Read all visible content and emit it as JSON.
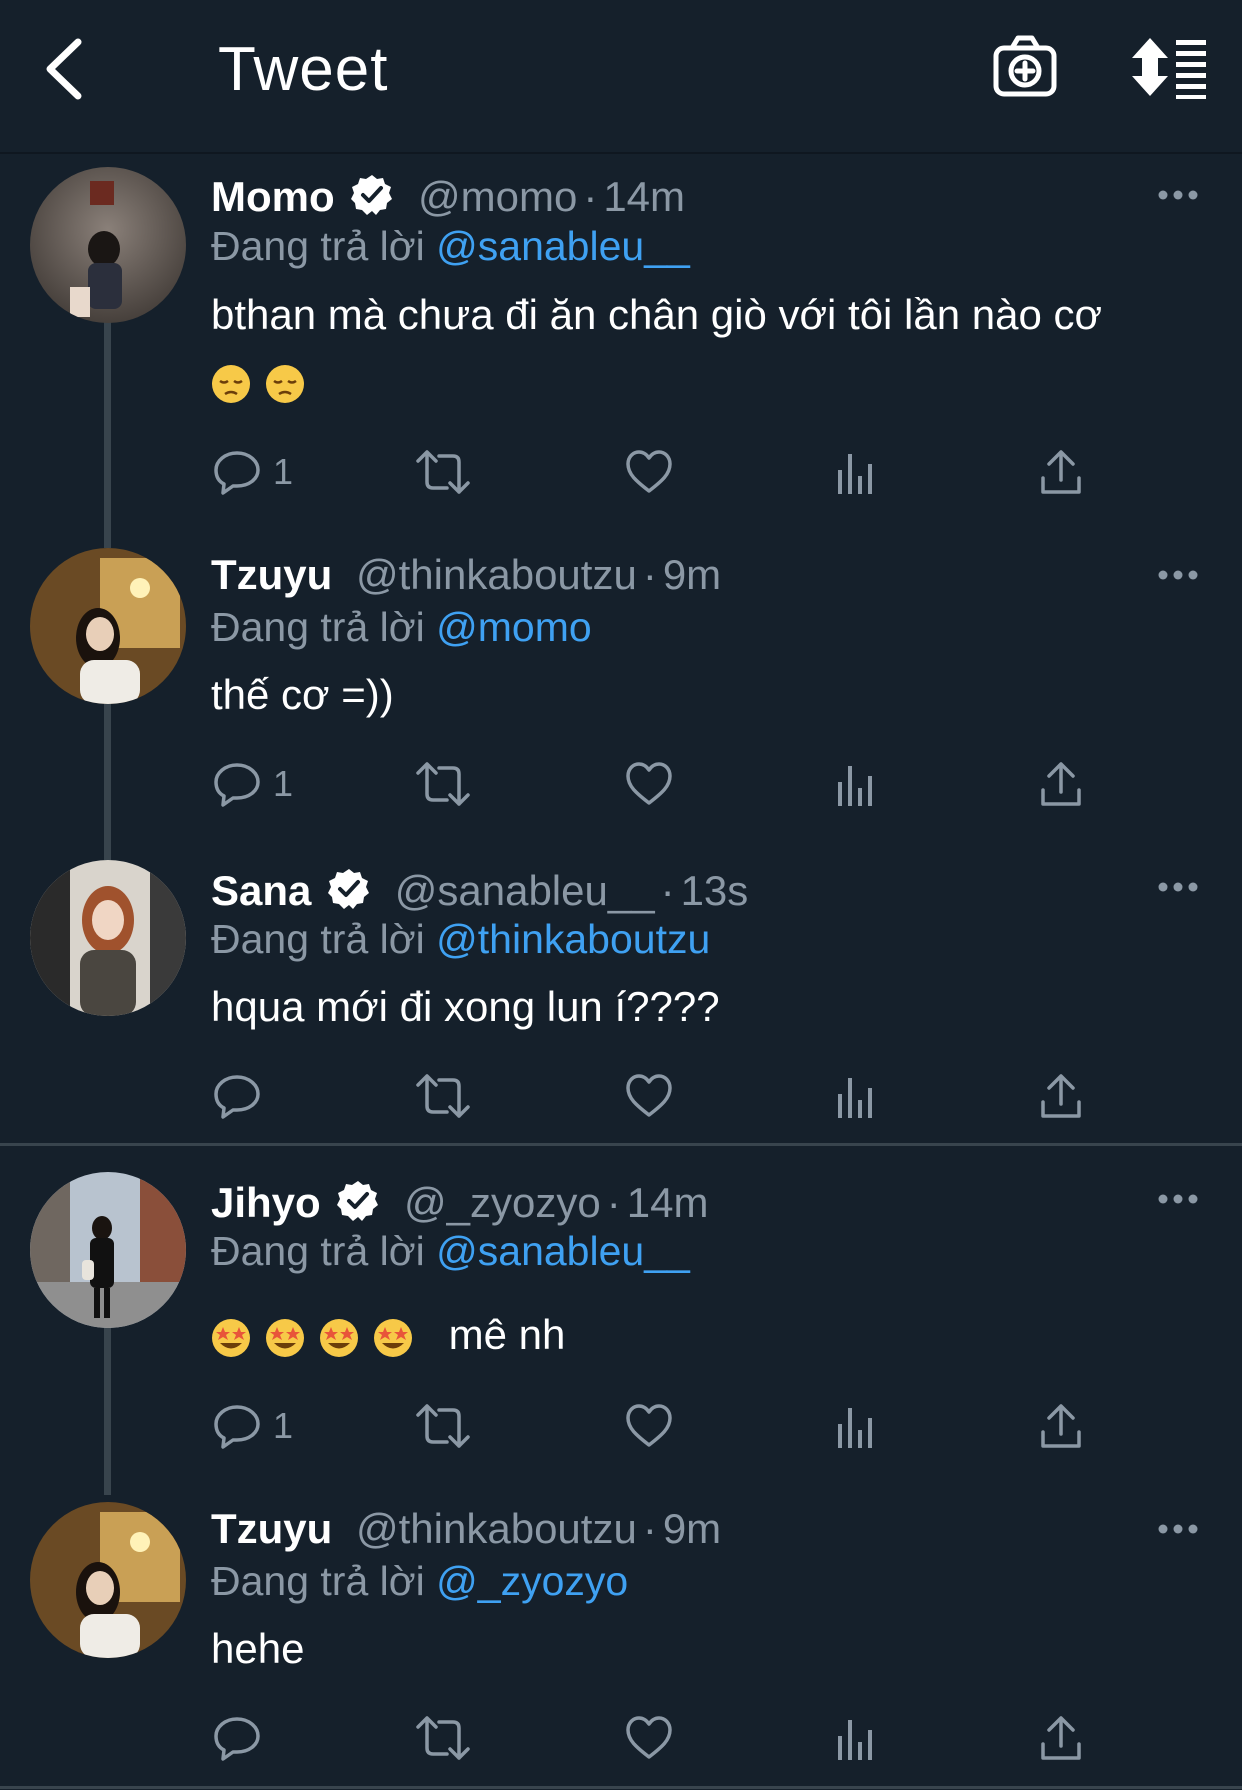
{
  "header": {
    "title": "Tweet",
    "back_icon": "chevron-left-icon",
    "camera_icon": "camera-add-icon",
    "sort_icon": "sort-list-icon"
  },
  "colors": {
    "background": "#15202b",
    "secondary_text": "#8b98a5",
    "mention": "#3fa1f2",
    "thread_line": "#38444d"
  },
  "reply_prefix": "Đang trả lời",
  "tweets": [
    {
      "name": "Momo",
      "verified": true,
      "handle": "@momo",
      "time": "14m",
      "reply_to": "@sanableu__",
      "text": "bthan mà chưa đi ăn chân giò với tôi lần nào cơ",
      "emoji": [
        "pensive-face",
        "pensive-face"
      ],
      "reply_count": "1"
    },
    {
      "name": "Tzuyu",
      "verified": false,
      "handle": "@thinkaboutzu",
      "time": "9m",
      "reply_to": "@momo",
      "text": "thế cơ =))",
      "reply_count": "1"
    },
    {
      "name": "Sana",
      "verified": true,
      "handle": "@sanableu__",
      "time": "13s",
      "reply_to": "@thinkaboutzu",
      "text": "hqua mới đi xong lun í????",
      "reply_count": ""
    },
    {
      "name": "Jihyo",
      "verified": true,
      "handle": "@_zyozyo",
      "time": "14m",
      "reply_to": "@sanableu__",
      "emoji": [
        "star-struck",
        "star-struck",
        "star-struck",
        "star-struck"
      ],
      "text": "mê nh",
      "reply_count": "1"
    },
    {
      "name": "Tzuyu",
      "verified": false,
      "handle": "@thinkaboutzu",
      "time": "9m",
      "reply_to": "@_zyozyo",
      "text": "hehe",
      "reply_count": ""
    }
  ]
}
